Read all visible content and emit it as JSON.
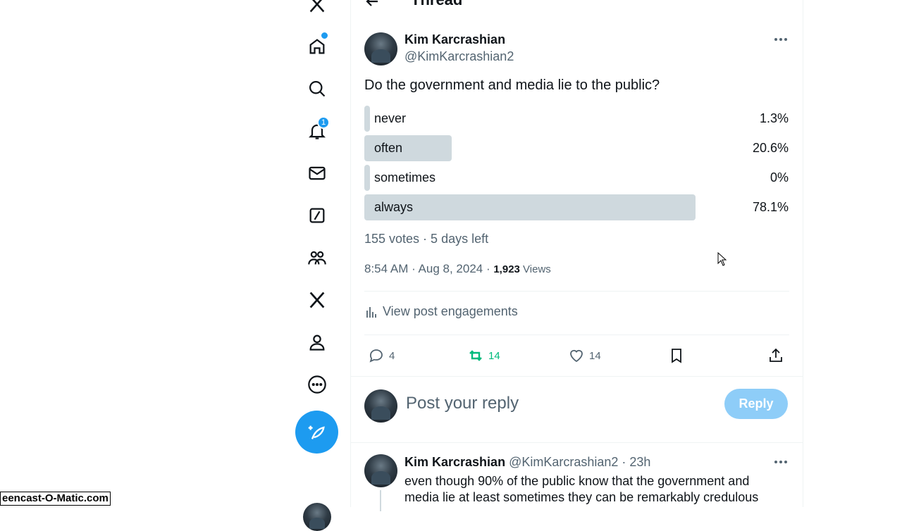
{
  "header": {
    "title": "Thread"
  },
  "nav": {
    "notifications_badge": "1"
  },
  "post": {
    "author_name": "Kim Karcrashian",
    "author_handle": "@KimKarcrashian2",
    "text": "Do the government and media lie to the public?",
    "poll": {
      "options": [
        {
          "label": "never",
          "pct_text": "1.3%",
          "pct": 1.3
        },
        {
          "label": "often",
          "pct_text": "20.6%",
          "pct": 20.6
        },
        {
          "label": "sometimes",
          "pct_text": "0%",
          "pct": 0
        },
        {
          "label": "always",
          "pct_text": "78.1%",
          "pct": 78.1
        }
      ],
      "summary": "155 votes · 5 days left"
    },
    "timestamp": "8:54 AM · Aug 8, 2024 · ",
    "views_count": "1,923",
    "views_label": " Views",
    "engagements_label": "View post engagements",
    "reply_count": "4",
    "repost_count": "14",
    "like_count": "14"
  },
  "reply_box": {
    "placeholder": "Post your reply",
    "button_label": "Reply"
  },
  "reply": {
    "author_name": "Kim Karcrashian",
    "meta": "@KimKarcrashian2 · 23h",
    "text_line1": "even though 90% of the public know that the government and",
    "text_line2": "media lie at least sometimes they can be remarkably credulous"
  },
  "watermark": "eencast-O-Matic.com",
  "colors": {
    "accent": "#1d9bf0",
    "repost": "#00ba7c",
    "poll_bar": "#cfd9de",
    "muted": "#536471"
  }
}
